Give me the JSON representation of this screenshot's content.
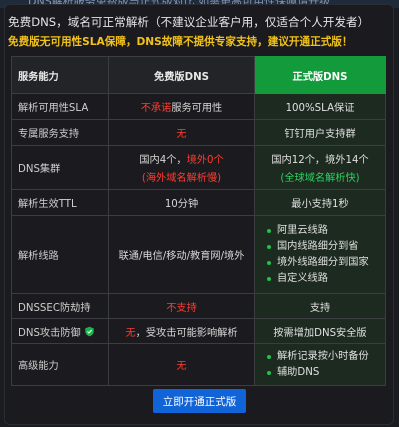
{
  "topstrip": {
    "fragment": "DNS解析服务免费版与正式版对比  如需更高可用性保障请升级"
  },
  "headline": "免费DNS，域名可正常解析（不建议企业客户用，仅适合个人开发者）",
  "subline": "免费版无可用性SLA保障，DNS故障不提供专家支持，建议开通正式版！",
  "table": {
    "headers": [
      "服务能力",
      "免费版DNS",
      "正式版DNS"
    ],
    "rows": [
      {
        "feature": "解析可用性SLA",
        "free_red": "不承诺",
        "free_rest": "服务可用性",
        "pro": "100%SLA保证"
      },
      {
        "feature": "专属服务支持",
        "free_red": "无",
        "pro": "钉钉用户支持群"
      },
      {
        "feature": "DNS集群",
        "free_line1_prefix": "国内4个，",
        "free_line1_red": "境外0个",
        "free_line2_red": "(海外域名解析慢)",
        "pro_line1": "国内12个，境外14个",
        "pro_line2_green": "(全球域名解析快)"
      },
      {
        "feature": "解析生效TTL",
        "free": "10分钟",
        "pro": "最小支持1秒"
      },
      {
        "feature": "解析线路",
        "free": "联通/电信/移动/教育网/境外",
        "pro_list": [
          "阿里云线路",
          "国内线路细分到省",
          "境外线路细分到国家",
          "自定义线路"
        ]
      },
      {
        "feature": "DNSSEC防劫持",
        "free_red": "不支持",
        "pro": "支持"
      },
      {
        "feature": "DNS攻击防御",
        "free_red": "无",
        "free_rest": "，受攻击可能影响解析",
        "pro": "按需增加DNS安全版"
      },
      {
        "feature": "高级能力",
        "free_red": "无",
        "pro_list": [
          "解析记录按小时备份",
          "辅助DNS"
        ]
      }
    ]
  },
  "button": {
    "label": "立即开通正式版"
  },
  "colors": {
    "accent_green": "#129a3b",
    "alert_red": "#ff3b30",
    "warn_yellow": "#f3c21a",
    "button_blue": "#1163d8"
  }
}
